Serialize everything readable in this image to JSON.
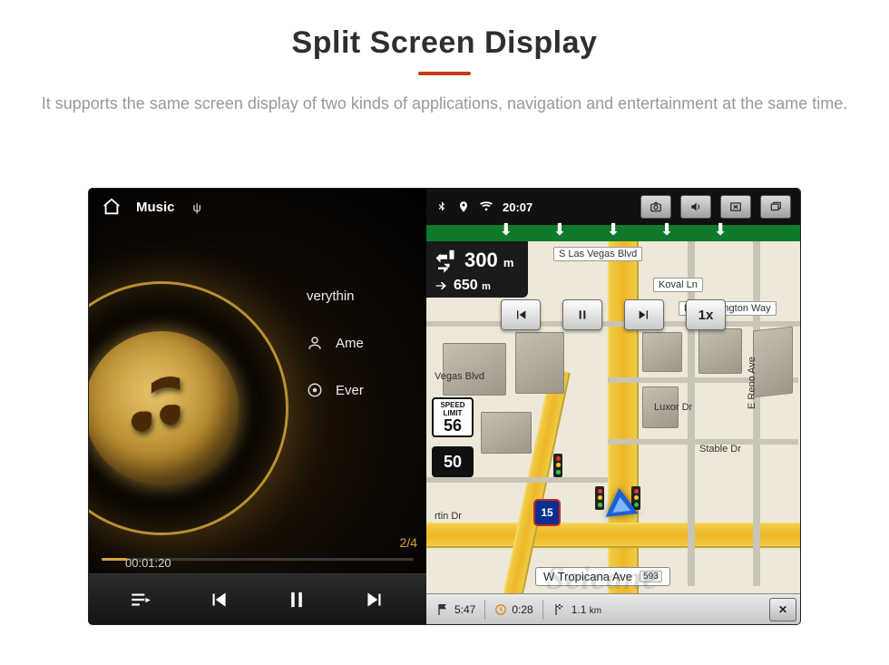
{
  "page": {
    "title": "Split Screen Display",
    "subtitle": "It supports the same screen display of two kinds of applications, navigation and entertainment at the same time."
  },
  "music": {
    "header_label": "Music",
    "usb_glyph": "ψ",
    "tracks": {
      "current_partial": "verythin",
      "artist_partial": "Ame",
      "album_partial": "Ever"
    },
    "counter": "2/4",
    "elapsed": "00:01:20"
  },
  "nav_status": {
    "clock": "20:07"
  },
  "route": {
    "turn_dist": "300",
    "turn_unit": "m",
    "next_dist": "650",
    "next_unit": "m"
  },
  "sim": {
    "speed_label": "1x"
  },
  "speed": {
    "limit_label_top": "SPEED",
    "limit_label_mid": "LIMIT",
    "limit_value": "56",
    "current": "50"
  },
  "streets": {
    "s_las_vegas": "S Las Vegas Blvd",
    "koval": "Koval Ln",
    "duke": "Duke Ellington Way",
    "vegas_blvd_partial": "Vegas Blvd",
    "luxor": "Luxor Dr",
    "ereno": "E Reno Ave",
    "stable": "Stable Dr",
    "rtin": "rtin Dr",
    "tropicana": "W Tropicana Ave",
    "tropicana_num": "593"
  },
  "shields": {
    "i15": "15"
  },
  "bottom": {
    "eta": "5:47",
    "time_rem": "0:28",
    "dist_rem": "1.1",
    "dist_unit": "km"
  },
  "watermark": "Seicane"
}
